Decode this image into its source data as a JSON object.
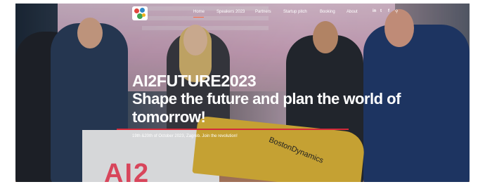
{
  "nav": {
    "items": [
      {
        "label": "Home",
        "active": true
      },
      {
        "label": "Speakers 2023"
      },
      {
        "label": "Partners"
      },
      {
        "label": "Startup pitch"
      },
      {
        "label": "Booking"
      },
      {
        "label": "About"
      }
    ],
    "icons": {
      "linkedin": "in",
      "twitter": "t",
      "facebook": "f",
      "search": "⚲"
    }
  },
  "hero": {
    "event": "AI2FUTURE2023",
    "headline": "Shape the future and plan the world of tomorrow!",
    "subline": "19th &20th of October 2023, Zagreb. Join the revolution!",
    "podium_text": "AI2",
    "robot_brand": "BostonDynamics"
  },
  "colors": {
    "accent": "#ff6a3d",
    "stage_red": "#d42a3a"
  }
}
